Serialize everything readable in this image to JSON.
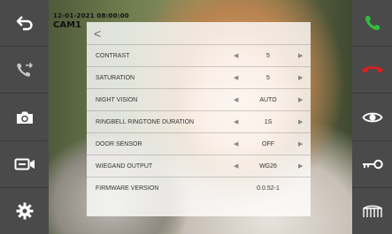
{
  "overlay": {
    "datetime": "12-01-2021 08:00:00",
    "camera": "CAM1"
  },
  "left_sidebar": [
    {
      "icon": "back-icon"
    },
    {
      "icon": "call-transfer-icon"
    },
    {
      "icon": "camera-snapshot-icon"
    },
    {
      "icon": "video-record-icon"
    },
    {
      "icon": "settings-gear-icon"
    }
  ],
  "right_sidebar": [
    {
      "icon": "call-answer-icon",
      "color": "#2fbf3a"
    },
    {
      "icon": "call-hangup-icon",
      "color": "#e01e1e"
    },
    {
      "icon": "monitor-eye-icon"
    },
    {
      "icon": "door-unlock-key-icon"
    },
    {
      "icon": "gate-open-icon"
    }
  ],
  "panel": {
    "back_symbol": "<",
    "rows": [
      {
        "label": "CONTRAST",
        "value": "5",
        "left": "◀",
        "right": "▶"
      },
      {
        "label": "SATURATION",
        "value": "5",
        "left": "◀",
        "right": "▶"
      },
      {
        "label": "NIGHT VISION",
        "value": "AUTO",
        "left": "◀",
        "right": "▶"
      },
      {
        "label": "RINGBELL RINGTONE DURATION",
        "value": "1S",
        "left": "◀",
        "right": "▶"
      },
      {
        "label": "DOOR SENSOR",
        "value": "OFF",
        "left": "◀",
        "right": "▶"
      },
      {
        "label": "WIEGAND OUTPUT",
        "value": "WG26",
        "left": "◀",
        "right": "▶"
      },
      {
        "label": "FIRMWARE VERSION",
        "value": "0.0.52-1"
      }
    ]
  }
}
